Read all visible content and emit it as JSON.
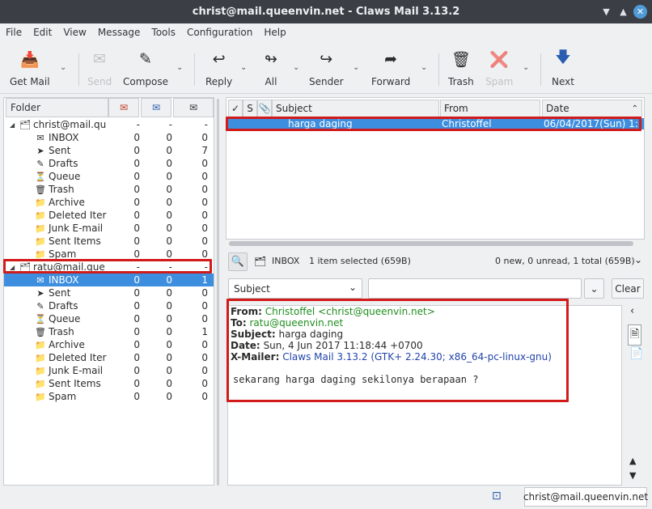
{
  "window": {
    "title": "christ@mail.queenvin.net - Claws Mail 3.13.2"
  },
  "menu": [
    "File",
    "Edit",
    "View",
    "Message",
    "Tools",
    "Configuration",
    "Help"
  ],
  "toolbar": {
    "get_mail": "Get Mail",
    "send": "Send",
    "compose": "Compose",
    "reply": "Reply",
    "all": "All",
    "sender": "Sender",
    "forward": "Forward",
    "trash": "Trash",
    "spam": "Spam",
    "next": "Next"
  },
  "folders": {
    "header": "Folder",
    "accounts": [
      {
        "name": "christ@mail.qu",
        "c1": "-",
        "c2": "-",
        "c3": "-",
        "items": [
          {
            "name": "INBOX",
            "icon": "inbox-icon",
            "c1": "0",
            "c2": "0",
            "c3": "0"
          },
          {
            "name": "Sent",
            "icon": "sent-icon",
            "c1": "0",
            "c2": "0",
            "c3": "7"
          },
          {
            "name": "Drafts",
            "icon": "drafts-icon",
            "c1": "0",
            "c2": "0",
            "c3": "0"
          },
          {
            "name": "Queue",
            "icon": "queue-icon",
            "c1": "0",
            "c2": "0",
            "c3": "0"
          },
          {
            "name": "Trash",
            "icon": "trash-icon",
            "c1": "0",
            "c2": "0",
            "c3": "0"
          },
          {
            "name": "Archive",
            "icon": "folder-icon",
            "c1": "0",
            "c2": "0",
            "c3": "0"
          },
          {
            "name": "Deleted Iter",
            "icon": "folder-icon",
            "c1": "0",
            "c2": "0",
            "c3": "0"
          },
          {
            "name": "Junk E-mail",
            "icon": "folder-icon",
            "c1": "0",
            "c2": "0",
            "c3": "0"
          },
          {
            "name": "Sent Items",
            "icon": "folder-icon",
            "c1": "0",
            "c2": "0",
            "c3": "0"
          },
          {
            "name": "Spam",
            "icon": "folder-icon",
            "c1": "0",
            "c2": "0",
            "c3": "0"
          }
        ]
      },
      {
        "name": "ratu@mail.que",
        "c1": "-",
        "c2": "-",
        "c3": "-",
        "items": [
          {
            "name": "INBOX",
            "icon": "inbox-icon",
            "c1": "0",
            "c2": "0",
            "c3": "1"
          },
          {
            "name": "Sent",
            "icon": "sent-icon",
            "c1": "0",
            "c2": "0",
            "c3": "0"
          },
          {
            "name": "Drafts",
            "icon": "drafts-icon",
            "c1": "0",
            "c2": "0",
            "c3": "0"
          },
          {
            "name": "Queue",
            "icon": "queue-icon",
            "c1": "0",
            "c2": "0",
            "c3": "0"
          },
          {
            "name": "Trash",
            "icon": "trash-icon",
            "c1": "0",
            "c2": "0",
            "c3": "1"
          },
          {
            "name": "Archive",
            "icon": "folder-icon",
            "c1": "0",
            "c2": "0",
            "c3": "0"
          },
          {
            "name": "Deleted Iter",
            "icon": "folder-icon",
            "c1": "0",
            "c2": "0",
            "c3": "0"
          },
          {
            "name": "Junk E-mail",
            "icon": "folder-icon",
            "c1": "0",
            "c2": "0",
            "c3": "0"
          },
          {
            "name": "Sent Items",
            "icon": "folder-icon",
            "c1": "0",
            "c2": "0",
            "c3": "0"
          },
          {
            "name": "Spam",
            "icon": "folder-icon",
            "c1": "0",
            "c2": "0",
            "c3": "0"
          }
        ]
      }
    ]
  },
  "message_list": {
    "columns": [
      "✓",
      "S",
      "Subject",
      "From",
      "Date"
    ],
    "rows": [
      {
        "subject": "harga daging",
        "from": "Christoffel",
        "date": "06/04/2017(Sun) 1:"
      }
    ]
  },
  "view_bar": {
    "folder": "INBOX",
    "selected": "1 item selected (659B)",
    "counts": "0 new, 0 unread, 1 total (659B)"
  },
  "search": {
    "field": "Subject",
    "value": "",
    "clear": "Clear"
  },
  "message": {
    "from_label": "From:",
    "from": "Christoffel <christ@queenvin.net>",
    "to_label": "To:",
    "to": "ratu@queenvin.net",
    "subject_label": "Subject:",
    "subject": "harga daging",
    "date_label": "Date:",
    "date": "Sun, 4 Jun 2017 11:18:44 +0700",
    "xmailer_label": "X-Mailer:",
    "xmailer": "Claws Mail 3.13.2 (GTK+ 2.24.30; x86_64-pc-linux-gnu)",
    "body": "sekarang harga daging sekilonya berapaan ?"
  },
  "status": {
    "account": "christ@mail.queenvin.net"
  },
  "colors": {
    "selection": "#3d8ede",
    "highlight_box": "#d11a1a",
    "titlebar": "#3b3f45"
  }
}
